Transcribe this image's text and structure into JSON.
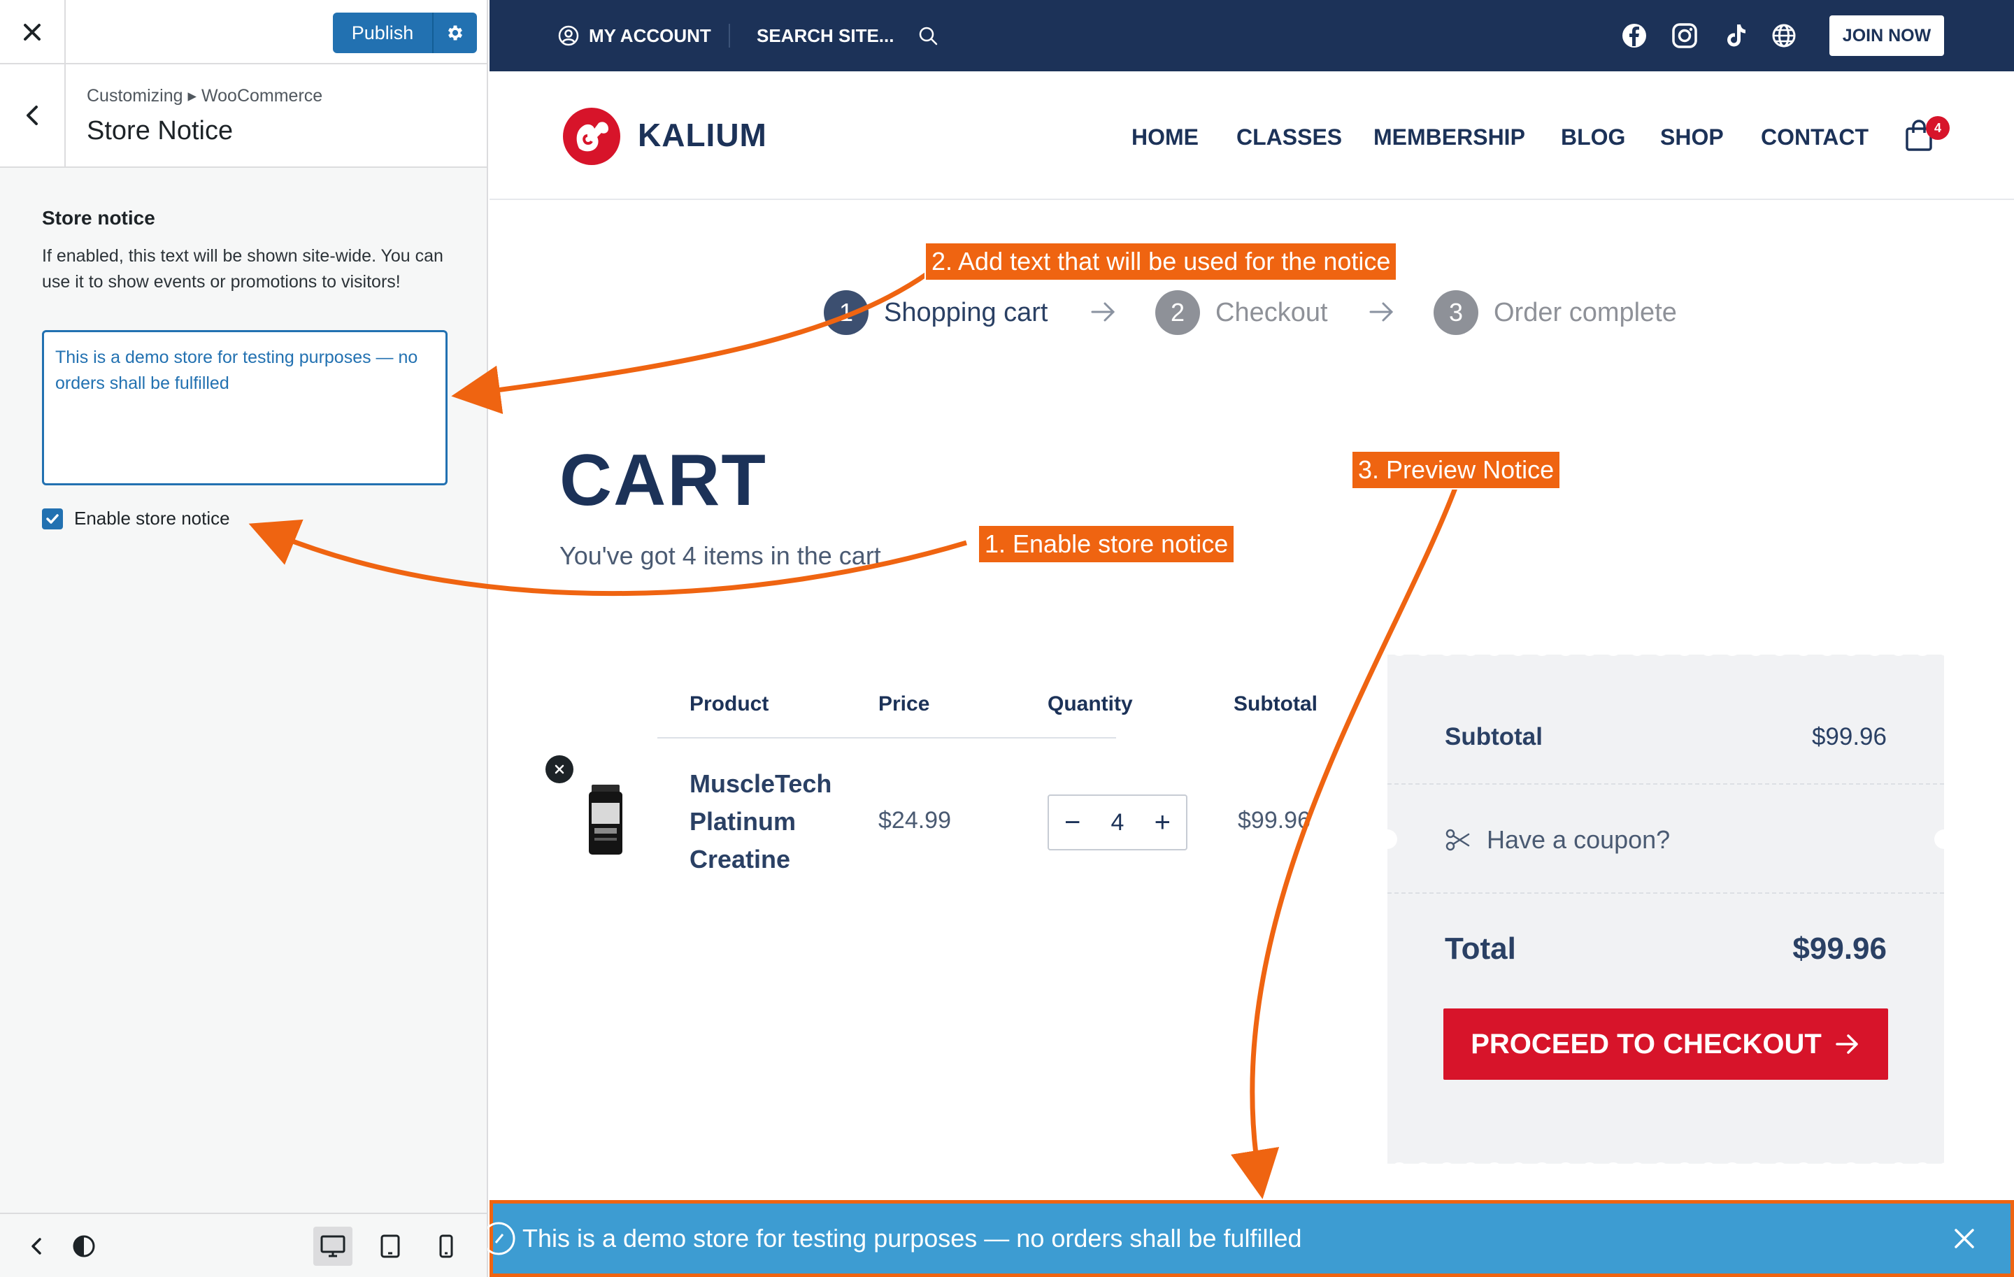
{
  "customizer": {
    "publish_label": "Publish",
    "breadcrumb": "Customizing ▸ WooCommerce",
    "section_title": "Store Notice",
    "field_label": "Store notice",
    "field_description": "If enabled, this text will be shown site-wide. You can use it to show events or promotions to visitors!",
    "notice_text_value": "This is a demo store for testing purposes — no orders shall be fulfilled",
    "enable_label": "Enable store notice",
    "enable_checked": true
  },
  "site": {
    "topbar": {
      "my_account": "MY ACCOUNT",
      "search": "SEARCH SITE...",
      "social_icons": [
        "facebook-icon",
        "instagram-icon",
        "tiktok-icon",
        "globe-icon"
      ],
      "join_label": "JOIN NOW",
      "bg_color": "#1c3258"
    },
    "logo_text": "KALIUM",
    "nav": [
      "HOME",
      "CLASSES",
      "MEMBERSHIP",
      "BLOG",
      "SHOP",
      "CONTACT"
    ],
    "cart_count": "4",
    "steps": [
      {
        "num": "1",
        "label": "Shopping cart",
        "active": true
      },
      {
        "num": "2",
        "label": "Checkout",
        "active": false
      },
      {
        "num": "3",
        "label": "Order complete",
        "active": false
      }
    ],
    "cart_title": "CART",
    "cart_subtitle": "You've got 4 items in the cart",
    "table_headers": [
      "Product",
      "Price",
      "Quantity",
      "Subtotal"
    ],
    "item": {
      "name": "MuscleTech Platinum Creatine",
      "price": "$24.99",
      "quantity": "4",
      "subtotal": "$99.96"
    },
    "totals": {
      "subtotal_label": "Subtotal",
      "subtotal_value": "$99.96",
      "coupon_label": "Have a coupon?",
      "total_label": "Total",
      "total_value": "$99.96",
      "checkout_label": "PROCEED TO CHECKOUT"
    },
    "store_notice": "This is a demo store for testing purposes — no orders shall be fulfilled",
    "accent_color": "#d7142a",
    "notice_color": "#3d9cd2"
  },
  "annotations": {
    "step1": "1. Enable store notice",
    "step2": "2. Add text that will be used for the notice",
    "step3": "3. Preview Notice",
    "color": "#ef6411"
  }
}
